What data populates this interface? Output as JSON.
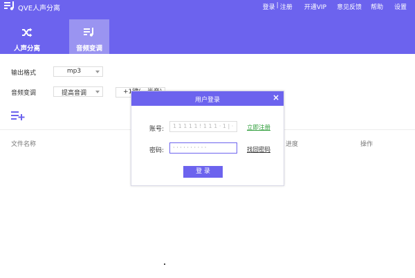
{
  "app": {
    "title": "QVE人声分离"
  },
  "top_menu": {
    "login": "登录",
    "separator": "|",
    "register": "注册",
    "vip": "开通VIP",
    "feedback": "意见反馈",
    "help": "帮助",
    "settings": "设置"
  },
  "tabs": [
    {
      "label": "人声分离",
      "icon": "shuffle-icon",
      "active": false
    },
    {
      "label": "音频变调",
      "icon": "music-list-icon",
      "active": true
    }
  ],
  "settings": {
    "output_format_label": "输出格式",
    "output_format_value": "mp3",
    "pitch_label": "音频变调",
    "pitch_mode_value": "提高音调",
    "pitch_amount_value": "+1键(一半音)"
  },
  "file_list": {
    "columns": {
      "name": "文件名称",
      "progress": "进度",
      "action": "操作"
    }
  },
  "login_dialog": {
    "title": "用户登录",
    "account_label": "账号:",
    "account_value": "1 1 1 1 1 ! 1 1 1 · 1 | ·",
    "password_label": "密码:",
    "password_value": "· · · · · · · · · ·",
    "register_link": "立即注册",
    "forgot_link": "找回密码",
    "login_button": "登 录"
  },
  "colors": {
    "accent": "#6c63ee",
    "active_tab": "#9a94f1",
    "register_link": "#2e9d3a"
  }
}
